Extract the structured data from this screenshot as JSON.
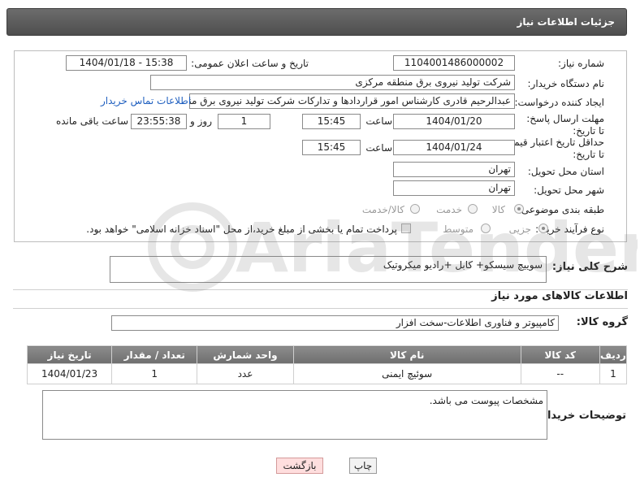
{
  "title": "جزئیات اطلاعات نیاز",
  "fields": {
    "need_number_label": "شماره نیاز:",
    "need_number": "1104001486000002",
    "announce_label": "تاریخ و ساعت اعلان عمومی:",
    "announce_value": "1404/01/18 - 15:38",
    "buyer_org_label": "نام دستگاه خریدار:",
    "buyer_org": "شرکت تولید نیروی برق منطقه مرکزی",
    "creator_label": "ایجاد کننده درخواست:",
    "creator": "عبدالرحیم قادری کارشناس امور قراردادها و تدارکات شرکت تولید نیروی برق منطقه مرکزی",
    "contact_link": "اطلاعات تماس خریدار",
    "reply_deadline_label": "مهلت ارسال پاسخ: تا تاریخ:",
    "reply_date": "1404/01/20",
    "time_label": "ساعت",
    "reply_time": "15:45",
    "days_value": "1",
    "days_label": "روز و",
    "remaining_value": "23:55:38",
    "remaining_label": "ساعت باقی مانده",
    "price_deadline_label": "حداقل تاریخ اعتبار قیمت: تا تاریخ:",
    "price_date": "1404/01/24",
    "price_time": "15:45",
    "province_label": "استان محل تحویل:",
    "province": "تهران",
    "city_label": "شهر محل تحویل:",
    "city": "تهران",
    "category_label": "طبقه بندی موضوعی:",
    "cat_goods": "کالا",
    "cat_service": "خدمت",
    "cat_both": "کالا/خدمت",
    "process_label": "نوع فرآیند خرید :",
    "proc_partial": "جزیی",
    "proc_medium": "متوسط",
    "payment_note": "پرداخت تمام یا بخشی از مبلغ خرید،از محل \"اسناد خزانه اسلامی\" خواهد بود."
  },
  "summary": {
    "label": "شرح کلی نیاز:",
    "value": "سوییچ سیسکو+ کابل +رادیو میکروتیک"
  },
  "goods_section": {
    "title": "اطلاعات کالاهای مورد نیاز",
    "group_label": "گروه کالا:",
    "group_value": "کامپیوتر و فناوری اطلاعات-سخت افزار"
  },
  "table": {
    "headers": [
      "ردیف",
      "کد کالا",
      "نام کالا",
      "واحد شمارش",
      "تعداد / مقدار",
      "تاریخ نیاز"
    ],
    "rows": [
      [
        "1",
        "--",
        "سوئیچ ایمنی",
        "عدد",
        "1",
        "1404/01/23"
      ]
    ]
  },
  "buyer_notes": {
    "label": "توضیحات خریدار:",
    "value": "مشخصات پیوست می باشد."
  },
  "buttons": {
    "print": "چاپ",
    "back": "بازگشت"
  },
  "watermark": "AriaTender.neT",
  "colors": {
    "header_bar": "#5a5a5a",
    "link": "#1f5fbf",
    "back_button": "#ffdede"
  }
}
